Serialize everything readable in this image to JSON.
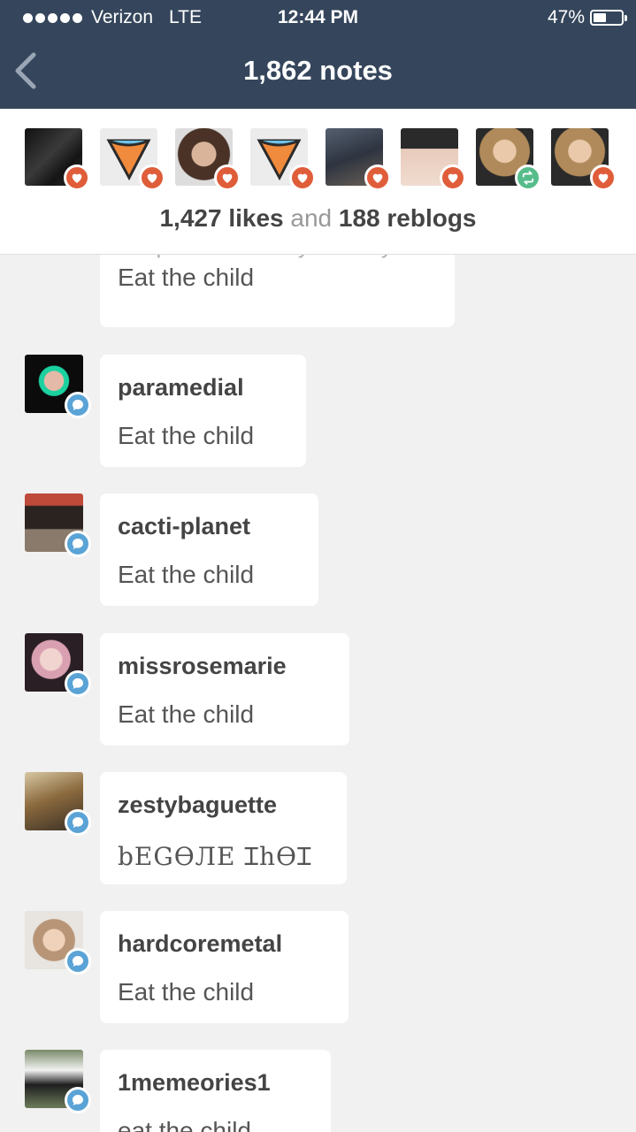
{
  "status_bar": {
    "carrier": "Verizon",
    "network": "LTE",
    "time": "12:44 PM",
    "battery": "47%",
    "battery_level": 0.47
  },
  "header": {
    "title": "1,862 notes"
  },
  "summary": {
    "likes": "1,427 likes",
    "and": "and",
    "reblogs": "188 reblogs",
    "avatar_badges": [
      "heart",
      "heart",
      "heart",
      "heart",
      "heart",
      "heart",
      "reblog",
      "heart"
    ]
  },
  "partial_note": {
    "reblog_source": "episodechooseyourstory",
    "message": "Eat the child"
  },
  "notes": [
    {
      "username": "paramedial",
      "message": "Eat the child"
    },
    {
      "username": "cacti-planet",
      "message": "Eat the child"
    },
    {
      "username": "missrosemarie",
      "message": "Eat the child"
    },
    {
      "username": "zestybaguette",
      "message": "bEGӨЛE ꞮhӨꞮ"
    },
    {
      "username": "hardcoremetal",
      "message": "Eat the child"
    },
    {
      "username": "1memeories1",
      "message": "eat the child"
    }
  ],
  "colors": {
    "header_bg": "#35465c",
    "like": "#e05d3a",
    "reblog": "#56bc8a",
    "reply": "#5aa3d6"
  }
}
